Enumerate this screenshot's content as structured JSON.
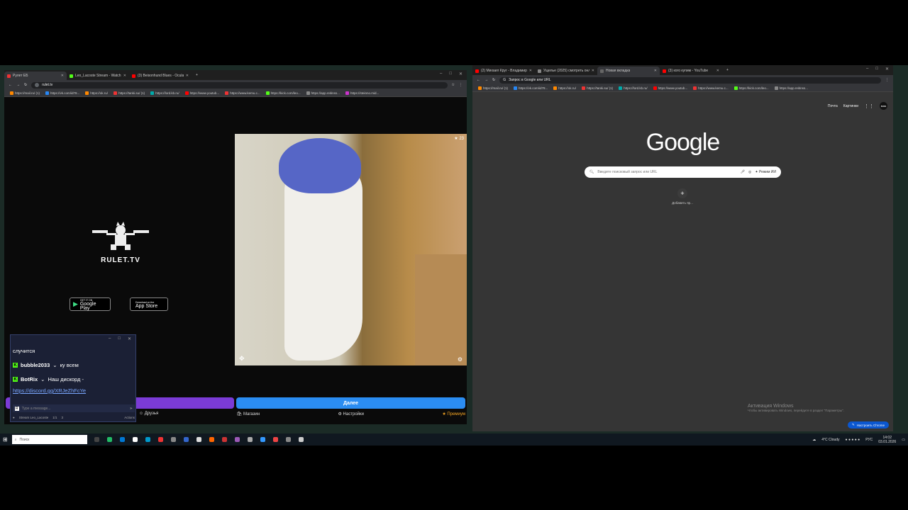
{
  "left_browser": {
    "tabs": [
      {
        "label": "Рулет ЕБ",
        "color": "#e33"
      },
      {
        "label": "Leo_Lacoste Stream - Watch L",
        "color": "#53fc18"
      },
      {
        "label": "(3) Beisonhund Blues - Ocular...",
        "color": "#f00"
      }
    ],
    "url": "rulet.tv",
    "bookmarks": [
      "https://mail.ru/ (1)",
      "https://vk.com/id78...",
      "https://ok.ru/",
      "https://tanki.su/ (1)",
      "https://lord.kb.ru/",
      "https://www.youtub...",
      "https://www.kemu.c...",
      "https://kick.com/leo...",
      "https://app.reitinss...",
      "https://steinno.mid..."
    ]
  },
  "rulet": {
    "logo_text": "RULET.TV",
    "google_play_small": "GET IT ON",
    "google_play": "Google Play",
    "app_store_small": "Download on the",
    "app_store": "App Store",
    "video_counter": "23",
    "next_button": "Далее",
    "nav": [
      "Друзья",
      "Магазин",
      "Настройки",
      "Премиум"
    ]
  },
  "chat": {
    "partial_line": "случится",
    "messages": [
      {
        "user": "bubble2033",
        "text": "ку всем"
      },
      {
        "user": "BotRix",
        "text": "Наш дискорд -"
      }
    ],
    "link": "https://discord.gg/XRJeZhFcYe",
    "input_placeholder": "Type a message...",
    "footer_user": "Stream Leo_Lacoste",
    "footer_count1": "1/1",
    "footer_count2": "3",
    "footer_right": "Actions"
  },
  "right_browser": {
    "tabs": [
      {
        "label": "(2) Михаил Круг - Владимирс...",
        "color": "#f00"
      },
      {
        "label": "Ущелье (2025) смотреть онлайн...",
        "color": "#888"
      },
      {
        "label": "Новая вкладка",
        "color": "#666"
      },
      {
        "label": "(3) кого купим - YouTube",
        "color": "#f00"
      }
    ],
    "url_placeholder": "Запрос в Google или URL",
    "bookmarks": [
      "https://mail.ru/ (1)",
      "https://vk.com/id78...",
      "https://ok.ru/",
      "https://tanki.su/ (1)",
      "https://lord.kb.ru/",
      "https://www.youtub...",
      "https://www.kemu.c...",
      "https://kick.com/leo...",
      "https://app.reitinss..."
    ],
    "top_links": [
      "Почта",
      "Картинки"
    ],
    "avatar": "вова",
    "google_logo": "Google",
    "search_placeholder": "Введите поисковый запрос или URL",
    "ai_mode": "Режим ИИ",
    "add_shortcut": "Добавить яр...",
    "activation_title": "Активация Windows",
    "activation_text": "Чтобы активировать Windows, перейдите в раздел \"Параметры\".",
    "customize": "Настроить Chrome"
  },
  "taskbar": {
    "search_placeholder": "Поиск",
    "weather": "4°C Cloudy",
    "lang": "РУС",
    "time": "14:02",
    "date": "03.01.2026"
  }
}
